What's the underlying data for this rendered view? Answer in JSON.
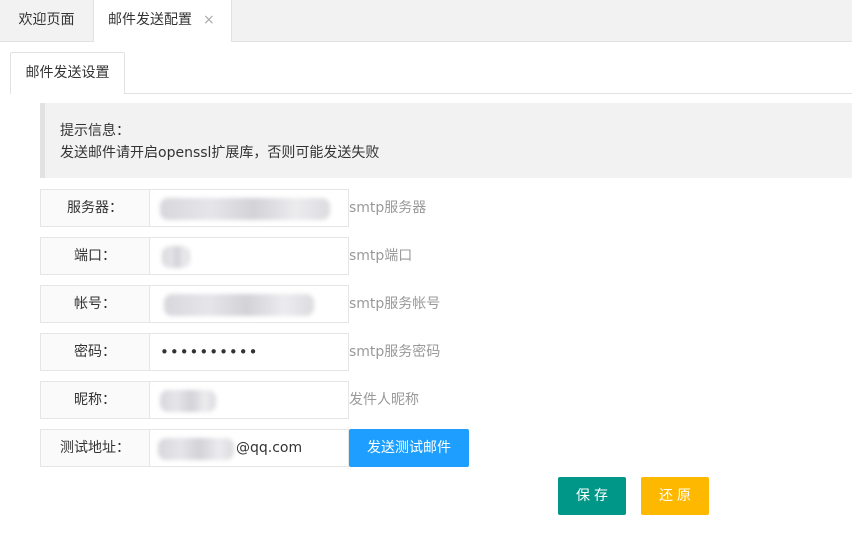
{
  "top_tabs": [
    {
      "label": "欢迎页面"
    },
    {
      "label": "邮件发送配置",
      "close": "×"
    }
  ],
  "sub_tab": {
    "label": "邮件发送设置"
  },
  "tip": {
    "line1": "提示信息：",
    "line2": "发送邮件请开启openssl扩展库，否则可能发送失败"
  },
  "form": {
    "server": {
      "label": "服务器：",
      "hint": "smtp服务器"
    },
    "port": {
      "label": "端口：",
      "hint": "smtp端口"
    },
    "account": {
      "label": "帐号：",
      "hint": "smtp服务帐号"
    },
    "password": {
      "label": "密码：",
      "value": "••••••••••",
      "hint": "smtp服务密码"
    },
    "nickname": {
      "label": "昵称：",
      "hint": "发件人昵称"
    },
    "test_address": {
      "label": "测试地址：",
      "value_suffix": "@qq.com",
      "button": "发送测试邮件"
    }
  },
  "actions": {
    "save": "保存",
    "reset": "还原"
  },
  "colors": {
    "accent_blue": "#1e9fff",
    "save_green": "#009688",
    "reset_orange": "#ffb800"
  }
}
